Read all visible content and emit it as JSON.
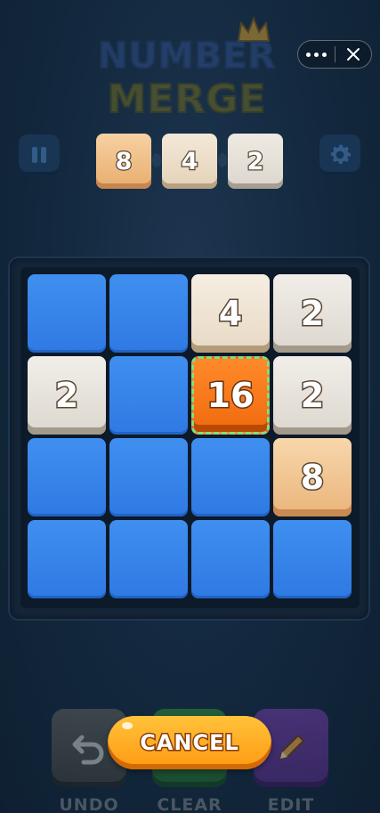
{
  "header": {
    "logo_line1": "NUMBER",
    "logo_line2": "MERGE",
    "menu": {
      "more_icon": "more-dots-icon",
      "close_icon": "close-icon"
    },
    "pause_icon": "pause-icon",
    "settings_icon": "gear-icon"
  },
  "next_tiles": [
    "8",
    "4",
    "2"
  ],
  "board": {
    "rows": 4,
    "cols": 4,
    "tiles": [
      {
        "row": 0,
        "col": 2,
        "value": "4",
        "style": "cream"
      },
      {
        "row": 0,
        "col": 3,
        "value": "2",
        "style": "grey"
      },
      {
        "row": 1,
        "col": 0,
        "value": "2",
        "style": "grey"
      },
      {
        "row": 1,
        "col": 2,
        "value": "16",
        "style": "orange",
        "selected": true
      },
      {
        "row": 1,
        "col": 3,
        "value": "2",
        "style": "grey"
      },
      {
        "row": 2,
        "col": 3,
        "value": "8",
        "style": "peach"
      }
    ]
  },
  "actions": {
    "undo_label": "UNDO",
    "clear_label": "CLEAR",
    "edit_label": "EDIT",
    "cancel_label": "CANCEL"
  },
  "colors": {
    "background": "#142a40",
    "empty_cell": "#3585ea",
    "cancel_button": "#ffb02a",
    "selection_outline": "#7be08a"
  }
}
